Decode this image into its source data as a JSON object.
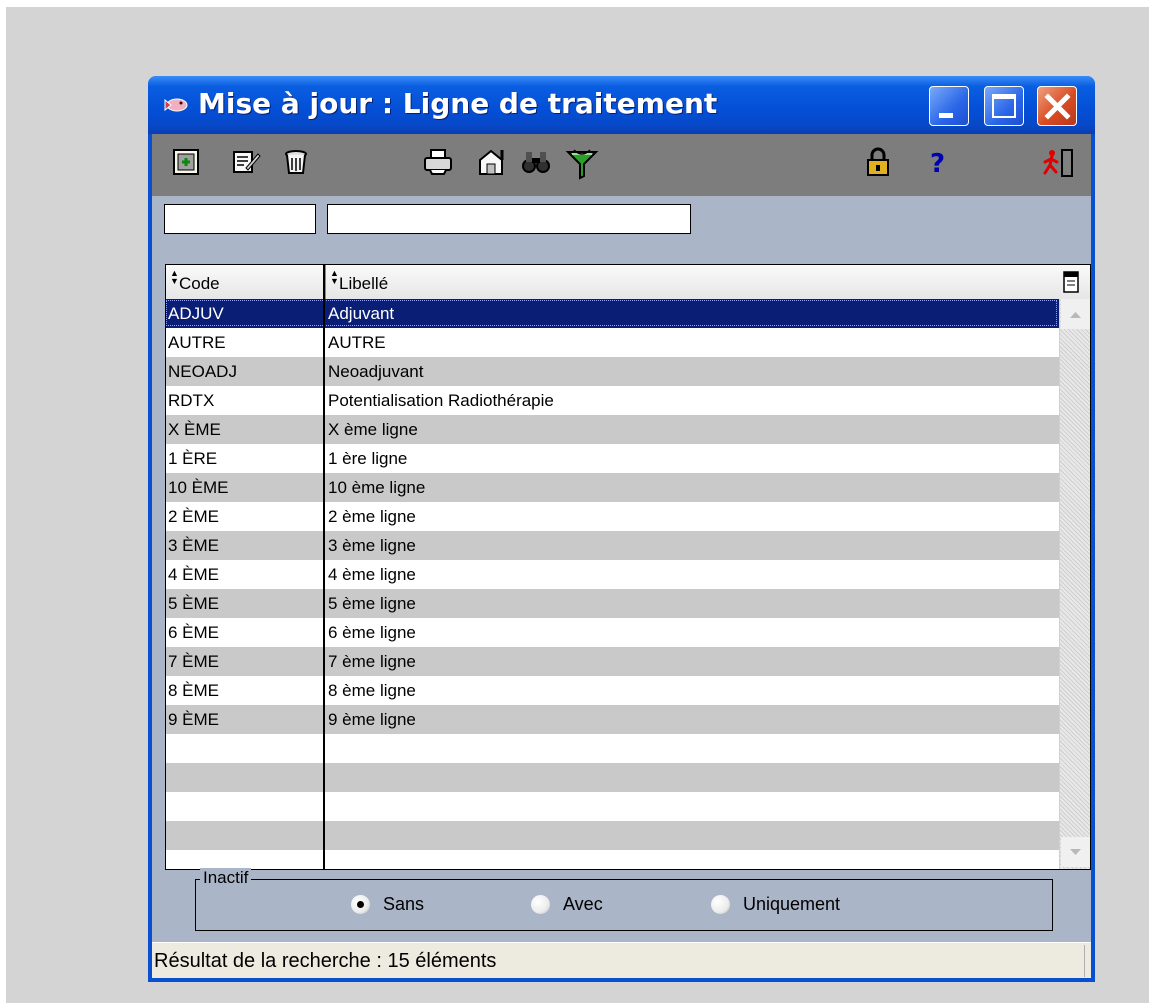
{
  "window": {
    "title": "Mise à jour : Ligne de traitement",
    "controls": [
      "minimize-icon",
      "maximize-icon",
      "close-icon"
    ]
  },
  "toolbar": {
    "left_tools": [
      "add-record-icon",
      "edit-record-icon",
      "delete-record-icon"
    ],
    "middle_tools": [
      "print-icon",
      "properties-icon",
      "search-binoculars-icon",
      "filter-funnel-icon"
    ],
    "right_tools": [
      "lock-icon",
      "help-icon",
      "exit-icon"
    ]
  },
  "filters": {
    "code_value": "",
    "libelle_value": ""
  },
  "grid": {
    "columns": [
      "Code",
      "Libellé"
    ],
    "rows": [
      {
        "code": "ADJUV",
        "libelle": "Adjuvant"
      },
      {
        "code": "AUTRE",
        "libelle": "AUTRE"
      },
      {
        "code": "NEOADJ",
        "libelle": "Neoadjuvant"
      },
      {
        "code": "RDTX",
        "libelle": "Potentialisation Radiothérapie"
      },
      {
        "code": "X ÈME",
        "libelle": "X ème ligne"
      },
      {
        "code": "1 ÈRE",
        "libelle": "1 ère ligne"
      },
      {
        "code": "10 ÈME",
        "libelle": "10 ème ligne"
      },
      {
        "code": "2 ÈME",
        "libelle": "2 ème ligne"
      },
      {
        "code": "3 ÈME",
        "libelle": "3 ème ligne"
      },
      {
        "code": "4 ÈME",
        "libelle": "4 ème ligne"
      },
      {
        "code": "5 ÈME",
        "libelle": "5 ème ligne"
      },
      {
        "code": "6 ÈME",
        "libelle": "6 ème ligne"
      },
      {
        "code": "7 ÈME",
        "libelle": "7 ème ligne"
      },
      {
        "code": "8 ÈME",
        "libelle": "8 ème ligne"
      },
      {
        "code": "9 ÈME",
        "libelle": "9 ème ligne"
      }
    ],
    "selected_index": 0,
    "empty_rows": 4
  },
  "inactif": {
    "label": "Inactif",
    "options": [
      "Sans",
      "Avec",
      "Uniquement"
    ],
    "selected": "Sans"
  },
  "status": {
    "text": "Résultat de la recherche : 15 éléments"
  },
  "colors": {
    "title_bar": "#0450d8",
    "selection": "#0a1e76",
    "close_button": "#d84c24",
    "client_bg": "#aab5c8"
  }
}
